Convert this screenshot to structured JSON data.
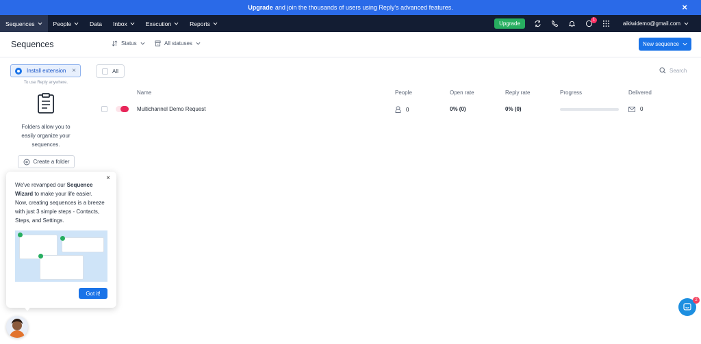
{
  "banner": {
    "bold": "Upgrade",
    "text": "and join the thousands of users using Reply's advanced features.",
    "close": "×"
  },
  "nav": {
    "items": [
      {
        "label": "Sequences",
        "dropdown": true
      },
      {
        "label": "People",
        "dropdown": true
      },
      {
        "label": "Data",
        "dropdown": false
      },
      {
        "label": "Inbox",
        "dropdown": true
      },
      {
        "label": "Execution",
        "dropdown": true
      },
      {
        "label": "Reports",
        "dropdown": true
      }
    ],
    "upgrade_label": "Upgrade",
    "notification_count": "1",
    "user_email": "aikiwidemo@gmail.com"
  },
  "header": {
    "title": "Sequences",
    "status_filter": "Status",
    "statuses_filter": "All statuses",
    "new_sequence": "New sequence"
  },
  "sidebar": {
    "install_extension": "Install extension",
    "install_hint": "To use Reply anywhere.",
    "folders_text": "Folders allow you to easily organize your sequences.",
    "create_folder": "Create a folder"
  },
  "list": {
    "all_label": "All",
    "search_placeholder": "Search",
    "columns": {
      "name": "Name",
      "people": "People",
      "open_rate": "Open rate",
      "reply_rate": "Reply rate",
      "progress": "Progress",
      "delivered": "Delivered"
    },
    "rows": [
      {
        "name": "Multichannel Demo Request",
        "people": "0",
        "open_rate": "0% (0)",
        "reply_rate": "0% (0)",
        "progress": 0,
        "delivered": "0"
      }
    ]
  },
  "popup": {
    "text_1": "We've revamped our",
    "bold_1": "Sequence Wizard",
    "text_2": "to make your life easier. Now, creating sequences is a breeze with just 3 simple steps - Contacts, Steps, and Settings.",
    "got_it": "Got it!",
    "close": "×"
  },
  "chat": {
    "badge": "2"
  },
  "colors": {
    "banner": "#2a6ae8",
    "nav": "#131d33",
    "primary": "#1a73e8",
    "upgrade": "#27ae60",
    "toggle": "#e8265a"
  }
}
